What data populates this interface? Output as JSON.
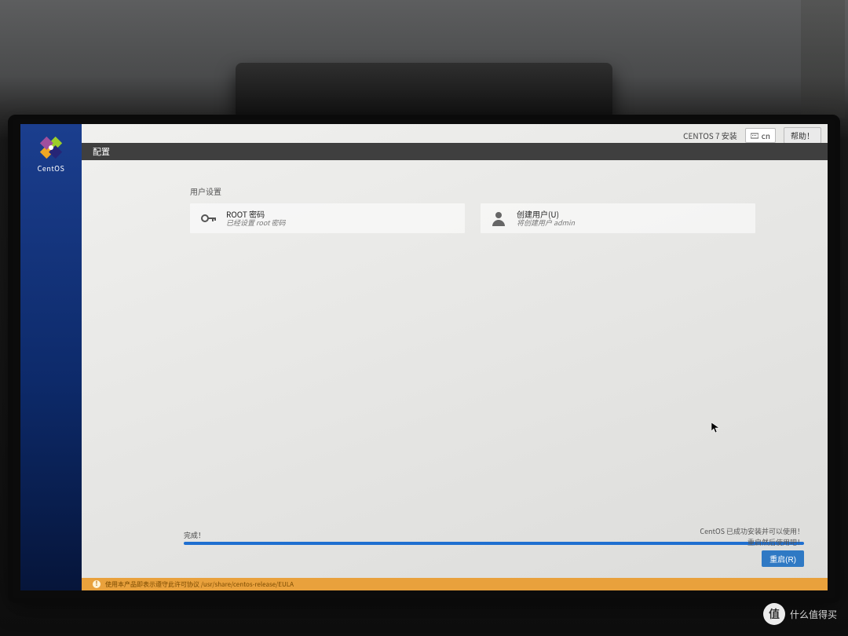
{
  "installer": {
    "product_title": "CENTOS 7 安装",
    "keyboard_layout": "cn",
    "help_label": "帮助！",
    "breadcrumb": "配置",
    "distro_name": "CentOS"
  },
  "user_settings": {
    "section_label": "用户设置",
    "root": {
      "title": "ROOT 密码",
      "status": "已经设置 root 密码"
    },
    "user": {
      "title": "创建用户(U)",
      "status": "将创建用户 admin"
    }
  },
  "progress": {
    "label": "完成！",
    "percent": 100
  },
  "finish": {
    "line1": "CentOS 已成功安装并可以使用！",
    "line2": "重启然后使用吧！",
    "reboot_label": "重启(R)"
  },
  "eula": {
    "text": "使用本产品即表示遵守此许可协议 /usr/share/centos-release/EULA"
  },
  "watermark": {
    "badge": "值",
    "text": "什么值得买"
  }
}
